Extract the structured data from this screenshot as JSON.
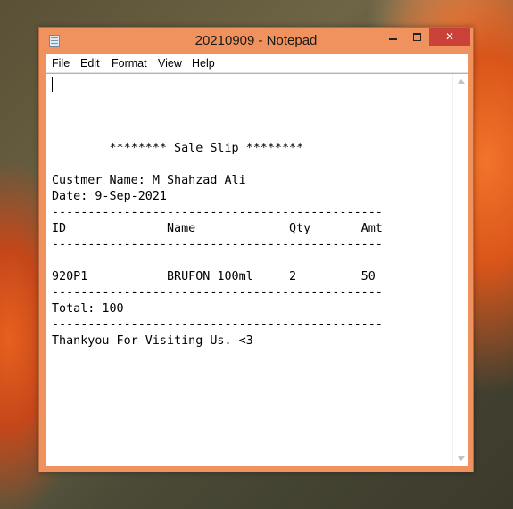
{
  "window": {
    "title": "20210909 - Notepad",
    "close_glyph": "✕"
  },
  "menu": [
    "File",
    "Edit",
    "Format",
    "View",
    "Help"
  ],
  "document": {
    "lines": [
      "",
      "",
      "",
      "        ******** Sale Slip ********",
      "",
      "Custmer Name: M Shahzad Ali",
      "Date: 9-Sep-2021",
      "----------------------------------------------",
      "ID              Name             Qty       Amt",
      "----------------------------------------------",
      "",
      "920P1           BRUFON 100ml     2         50",
      "----------------------------------------------",
      "Total: 100",
      "----------------------------------------------",
      "Thankyou For Visiting Us. <3"
    ]
  },
  "colors": {
    "frame": "#f0925e",
    "close_button": "#c94139",
    "editor_background": "#ffffff"
  },
  "icons": {
    "app": "notepad-icon",
    "minimize": "minimize-icon",
    "maximize": "maximize-icon",
    "close": "close-icon"
  }
}
